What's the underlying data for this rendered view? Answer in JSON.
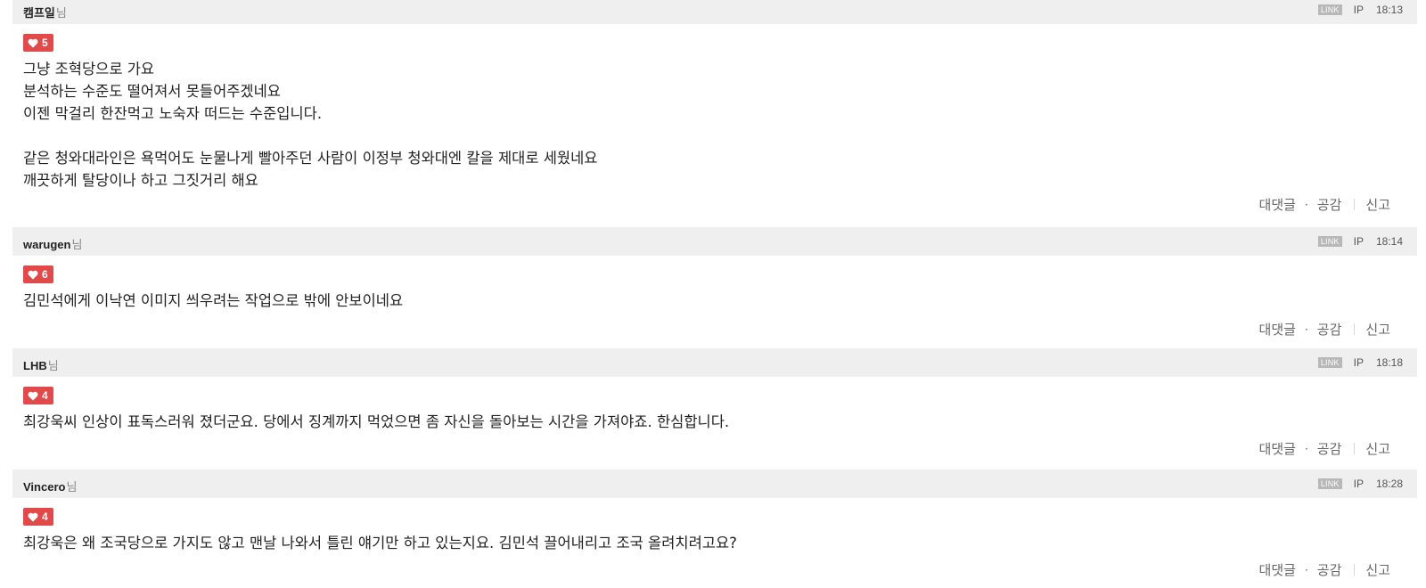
{
  "comments": [
    {
      "author": "캠프일",
      "honorific": "님",
      "link_label": "LINK",
      "ip_label": "IP",
      "time": "18:13",
      "likes": "5",
      "lines": [
        "그냥 조혁당으로 가요",
        "분석하는 수준도 떨어져서 못들어주겠네요",
        "이젠 막걸리 한잔먹고 노숙자 떠드는 수준입니다.",
        "",
        "같은 청와대라인은 욕먹어도 눈물나게 빨아주던 사람이 이정부 청와대엔 칼을 제대로 세웠네요",
        "깨끗하게 탈당이나 하고 그짓거리 해요"
      ],
      "reply_label": "대댓글",
      "like_label": "공감",
      "report_label": "신고"
    },
    {
      "author": "warugen",
      "honorific": "님",
      "link_label": "LINK",
      "ip_label": "IP",
      "time": "18:14",
      "likes": "6",
      "lines": [
        "김민석에게 이낙연 이미지 씌우려는 작업으로 밖에 안보이네요"
      ],
      "reply_label": "대댓글",
      "like_label": "공감",
      "report_label": "신고"
    },
    {
      "author": "LHB",
      "honorific": "님",
      "link_label": "LINK",
      "ip_label": "IP",
      "time": "18:18",
      "likes": "4",
      "lines": [
        "최강욱씨 인상이 표독스러워 졌더군요. 당에서 징계까지 먹었으면 좀 자신을 돌아보는 시간을 가져야죠. 한심합니다."
      ],
      "reply_label": "대댓글",
      "like_label": "공감",
      "report_label": "신고"
    },
    {
      "author": "Vincero",
      "honorific": "님",
      "link_label": "LINK",
      "ip_label": "IP",
      "time": "18:28",
      "likes": "4",
      "lines": [
        "최강욱은 왜 조국당으로 가지도 않고 맨날 나와서 틀린 얘기만 하고 있는지요. 김민석 끌어내리고 조국 올려치려고요?"
      ],
      "reply_label": "대댓글",
      "like_label": "공감",
      "report_label": "신고"
    }
  ],
  "icons": {
    "heart": "heart-icon"
  },
  "colors": {
    "like_badge": "#e14a4a",
    "header_bg": "#efefef",
    "link_badge": "#b8b8b8"
  }
}
